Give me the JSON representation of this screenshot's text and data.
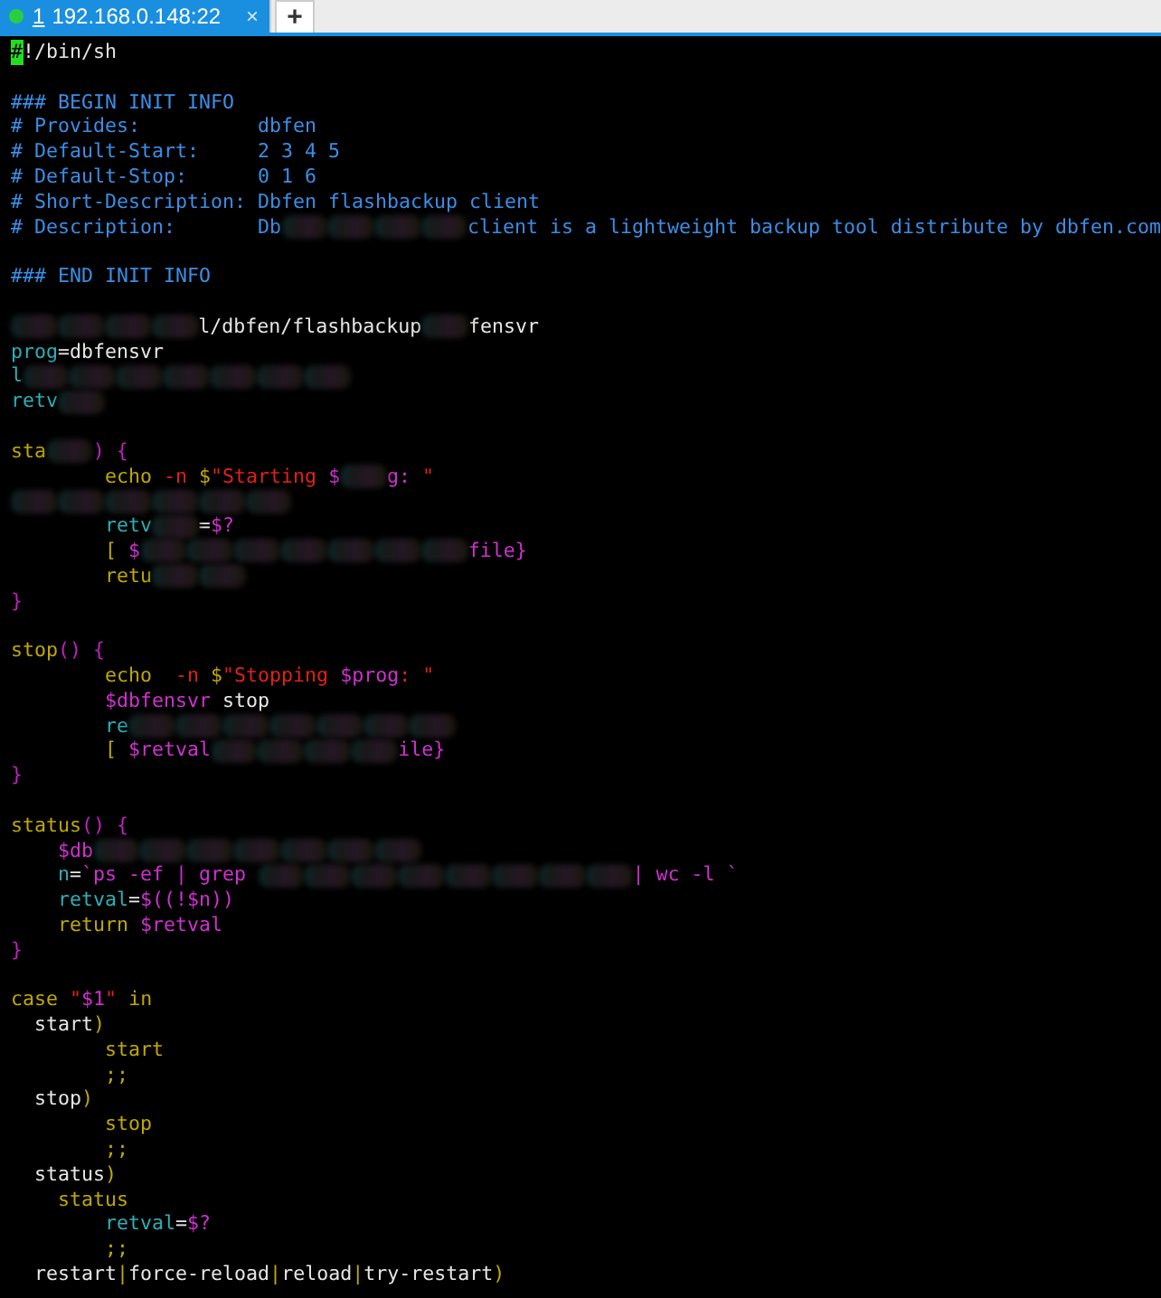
{
  "tabs": [
    {
      "number": "1",
      "host": "192.168.0.148:22",
      "close": "×",
      "selected": true,
      "connected": true
    }
  ],
  "new_tab": "+",
  "terminal": {
    "lines": [
      {
        "kind": "code",
        "segments": [
          {
            "kind": "comment",
            "text": "#",
            "cursor": true
          },
          {
            "kind": "plain",
            "text": "!/bin/sh"
          }
        ]
      },
      {
        "kind": "blank"
      },
      {
        "kind": "code",
        "segments": [
          {
            "kind": "comment",
            "text": "### BEGIN INIT INFO"
          }
        ]
      },
      {
        "kind": "code",
        "segments": [
          {
            "kind": "comment",
            "text": "# Provides:          dbfen"
          }
        ]
      },
      {
        "kind": "code",
        "segments": [
          {
            "kind": "comment",
            "text": "# Default-Start:     2 3 4 5"
          }
        ]
      },
      {
        "kind": "code",
        "segments": [
          {
            "kind": "comment",
            "text": "# Default-Stop:      0 1 6"
          }
        ]
      },
      {
        "kind": "code",
        "segments": [
          {
            "kind": "comment",
            "text": "# Short-Description: Dbfen flashbackup client"
          }
        ]
      },
      {
        "kind": "code",
        "segments": [
          {
            "kind": "comment",
            "text": "# Description:       Db"
          },
          {
            "kind": "smudge"
          },
          {
            "kind": "smudge"
          },
          {
            "kind": "smudge"
          },
          {
            "kind": "smudge"
          },
          {
            "kind": "comment",
            "text": "client is a lightweight backup tool distribute by dbfen.com"
          }
        ]
      },
      {
        "kind": "blank"
      },
      {
        "kind": "code",
        "segments": [
          {
            "kind": "comment",
            "text": "### END INIT INFO"
          }
        ]
      },
      {
        "kind": "blank"
      },
      {
        "kind": "code",
        "segments": [
          {
            "kind": "smudge"
          },
          {
            "kind": "smudge"
          },
          {
            "kind": "smudge"
          },
          {
            "kind": "smudge"
          },
          {
            "kind": "plain",
            "text": "l/dbfen/flashbackup"
          },
          {
            "kind": "smudge"
          },
          {
            "kind": "plain",
            "text": "fensvr"
          }
        ]
      },
      {
        "kind": "code",
        "segments": [
          {
            "kind": "assign",
            "text": "prog"
          },
          {
            "kind": "plain",
            "text": "=dbfensvr"
          }
        ]
      },
      {
        "kind": "code",
        "segments": [
          {
            "kind": "assign",
            "text": "l"
          },
          {
            "kind": "smudge"
          },
          {
            "kind": "smudge"
          },
          {
            "kind": "smudge"
          },
          {
            "kind": "smudge"
          },
          {
            "kind": "smudge"
          },
          {
            "kind": "smudge"
          },
          {
            "kind": "smudge"
          }
        ]
      },
      {
        "kind": "code",
        "segments": [
          {
            "kind": "assign",
            "text": "retv"
          },
          {
            "kind": "smudge"
          }
        ]
      },
      {
        "kind": "blank"
      },
      {
        "kind": "code",
        "segments": [
          {
            "kind": "keyword",
            "text": "sta"
          },
          {
            "kind": "smudge"
          },
          {
            "kind": "bracket",
            "text": ") {"
          }
        ]
      },
      {
        "kind": "code",
        "segments": [
          {
            "kind": "keyword",
            "text": "        echo"
          },
          {
            "kind": "string",
            "text": " -n "
          },
          {
            "kind": "keyword",
            "text": "$"
          },
          {
            "kind": "string",
            "text": "\"Starting "
          },
          {
            "kind": "var",
            "text": "$"
          },
          {
            "kind": "smudge"
          },
          {
            "kind": "var",
            "text": "g:"
          },
          {
            "kind": "string",
            "text": " \""
          }
        ]
      },
      {
        "kind": "code",
        "segments": [
          {
            "kind": "smudge"
          },
          {
            "kind": "smudge"
          },
          {
            "kind": "smudge"
          },
          {
            "kind": "smudge"
          },
          {
            "kind": "smudge"
          },
          {
            "kind": "smudge"
          }
        ]
      },
      {
        "kind": "code",
        "segments": [
          {
            "kind": "assign",
            "text": "        retv"
          },
          {
            "kind": "smudge"
          },
          {
            "kind": "plain",
            "text": "="
          },
          {
            "kind": "var",
            "text": "$?"
          }
        ]
      },
      {
        "kind": "code",
        "segments": [
          {
            "kind": "keyword",
            "text": "        ["
          },
          {
            "kind": "var",
            "text": " $"
          },
          {
            "kind": "smudge"
          },
          {
            "kind": "smudge"
          },
          {
            "kind": "smudge"
          },
          {
            "kind": "smudge"
          },
          {
            "kind": "smudge"
          },
          {
            "kind": "smudge"
          },
          {
            "kind": "smudge"
          },
          {
            "kind": "var",
            "text": "file}"
          }
        ]
      },
      {
        "kind": "code",
        "segments": [
          {
            "kind": "keyword",
            "text": "        retu"
          },
          {
            "kind": "smudge"
          },
          {
            "kind": "smudge"
          }
        ]
      },
      {
        "kind": "code",
        "segments": [
          {
            "kind": "bracket",
            "text": "}"
          }
        ]
      },
      {
        "kind": "blank"
      },
      {
        "kind": "code",
        "segments": [
          {
            "kind": "keyword",
            "text": "stop"
          },
          {
            "kind": "bracket",
            "text": "() {"
          }
        ]
      },
      {
        "kind": "code",
        "segments": [
          {
            "kind": "keyword",
            "text": "        echo"
          },
          {
            "kind": "string",
            "text": "  -n "
          },
          {
            "kind": "keyword",
            "text": "$"
          },
          {
            "kind": "string",
            "text": "\"Stopping "
          },
          {
            "kind": "var",
            "text": "$prog"
          },
          {
            "kind": "string",
            "text": ": \""
          }
        ]
      },
      {
        "kind": "code",
        "segments": [
          {
            "kind": "var",
            "text": "        $dbfensvr"
          },
          {
            "kind": "plain",
            "text": " stop"
          }
        ]
      },
      {
        "kind": "code",
        "segments": [
          {
            "kind": "assign",
            "text": "        re"
          },
          {
            "kind": "smudge"
          },
          {
            "kind": "smudge"
          },
          {
            "kind": "smudge"
          },
          {
            "kind": "smudge"
          },
          {
            "kind": "smudge"
          },
          {
            "kind": "smudge"
          },
          {
            "kind": "smudge"
          }
        ]
      },
      {
        "kind": "code",
        "segments": [
          {
            "kind": "keyword",
            "text": "        ["
          },
          {
            "kind": "var",
            "text": " $retval"
          },
          {
            "kind": "smudge"
          },
          {
            "kind": "smudge"
          },
          {
            "kind": "smudge"
          },
          {
            "kind": "smudge"
          },
          {
            "kind": "var",
            "text": "ile}"
          }
        ]
      },
      {
        "kind": "code",
        "segments": [
          {
            "kind": "bracket",
            "text": "}"
          }
        ]
      },
      {
        "kind": "blank"
      },
      {
        "kind": "code",
        "segments": [
          {
            "kind": "keyword",
            "text": "status"
          },
          {
            "kind": "bracket",
            "text": "() {"
          }
        ]
      },
      {
        "kind": "code",
        "segments": [
          {
            "kind": "var",
            "text": "    $db"
          },
          {
            "kind": "smudge"
          },
          {
            "kind": "smudge"
          },
          {
            "kind": "smudge"
          },
          {
            "kind": "smudge"
          },
          {
            "kind": "smudge"
          },
          {
            "kind": "smudge"
          },
          {
            "kind": "smudge"
          }
        ]
      },
      {
        "kind": "code",
        "segments": [
          {
            "kind": "assign",
            "text": "    n"
          },
          {
            "kind": "plain",
            "text": "="
          },
          {
            "kind": "var",
            "text": "`ps -ef | grep "
          },
          {
            "kind": "smudge"
          },
          {
            "kind": "smudge"
          },
          {
            "kind": "smudge"
          },
          {
            "kind": "smudge"
          },
          {
            "kind": "smudge"
          },
          {
            "kind": "smudge"
          },
          {
            "kind": "smudge"
          },
          {
            "kind": "smudge"
          },
          {
            "kind": "var",
            "text": "| wc -l `"
          }
        ]
      },
      {
        "kind": "code",
        "segments": [
          {
            "kind": "assign",
            "text": "    retval"
          },
          {
            "kind": "plain",
            "text": "="
          },
          {
            "kind": "var",
            "text": "$((!$n))"
          }
        ]
      },
      {
        "kind": "code",
        "segments": [
          {
            "kind": "keyword",
            "text": "    return"
          },
          {
            "kind": "var",
            "text": " $retval"
          }
        ]
      },
      {
        "kind": "code",
        "segments": [
          {
            "kind": "bracket",
            "text": "}"
          }
        ]
      },
      {
        "kind": "blank"
      },
      {
        "kind": "code",
        "segments": [
          {
            "kind": "keyword",
            "text": "case "
          },
          {
            "kind": "string",
            "text": "\""
          },
          {
            "kind": "var",
            "text": "$1"
          },
          {
            "kind": "string",
            "text": "\""
          },
          {
            "kind": "keyword",
            "text": " in"
          }
        ]
      },
      {
        "kind": "code",
        "segments": [
          {
            "kind": "plain",
            "text": "  start"
          },
          {
            "kind": "keyword",
            "text": ")"
          }
        ]
      },
      {
        "kind": "code",
        "segments": [
          {
            "kind": "keyword",
            "text": "        start"
          }
        ]
      },
      {
        "kind": "code",
        "segments": [
          {
            "kind": "keyword",
            "text": "        ;;"
          }
        ]
      },
      {
        "kind": "code",
        "segments": [
          {
            "kind": "plain",
            "text": "  stop"
          },
          {
            "kind": "keyword",
            "text": ")"
          }
        ]
      },
      {
        "kind": "code",
        "segments": [
          {
            "kind": "keyword",
            "text": "        stop"
          }
        ]
      },
      {
        "kind": "code",
        "segments": [
          {
            "kind": "keyword",
            "text": "        ;;"
          }
        ]
      },
      {
        "kind": "code",
        "segments": [
          {
            "kind": "plain",
            "text": "  status"
          },
          {
            "kind": "keyword",
            "text": ")"
          }
        ]
      },
      {
        "kind": "code",
        "segments": [
          {
            "kind": "keyword",
            "text": "    status"
          }
        ]
      },
      {
        "kind": "code",
        "segments": [
          {
            "kind": "assign",
            "text": "        retval"
          },
          {
            "kind": "plain",
            "text": "="
          },
          {
            "kind": "var",
            "text": "$?"
          }
        ]
      },
      {
        "kind": "code",
        "segments": [
          {
            "kind": "keyword",
            "text": "        ;;"
          }
        ]
      },
      {
        "kind": "code",
        "segments": [
          {
            "kind": "plain",
            "text": "  restart"
          },
          {
            "kind": "keyword",
            "text": "|"
          },
          {
            "kind": "plain",
            "text": "force-reload"
          },
          {
            "kind": "keyword",
            "text": "|"
          },
          {
            "kind": "plain",
            "text": "reload"
          },
          {
            "kind": "keyword",
            "text": "|"
          },
          {
            "kind": "plain",
            "text": "try-restart"
          },
          {
            "kind": "keyword",
            "text": ")"
          }
        ]
      }
    ]
  }
}
